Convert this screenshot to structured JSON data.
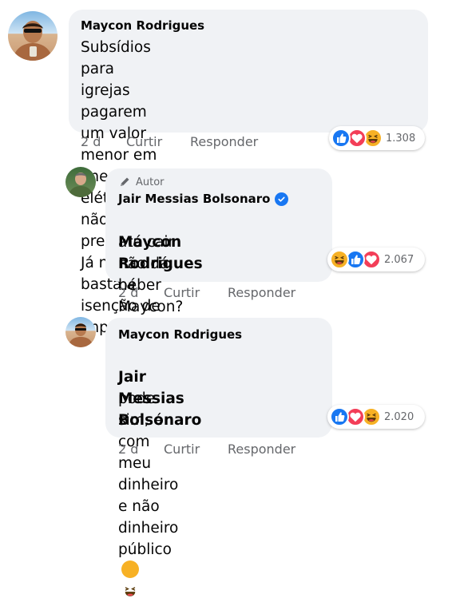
{
  "comments": [
    {
      "author": "Maycon Rodrigues",
      "text": "Subsídios para igrejas pagarem um valor\nmenor em energia elétrica, aí não né\npresidente. Já não basta a isenção de\nimpostos",
      "time": "2 d",
      "like_label": "Curtir",
      "reply_label": "Responder",
      "reaction_count": "1.308"
    },
    {
      "badge": "Autor",
      "author": "Jair Messias Bolsonaro",
      "tag": "Maycon Rodrigues",
      "text_first": " beber",
      "text_rest": "até cair não dá, né\nMaycon?",
      "time": "2 d",
      "like_label": "Curtir",
      "reply_label": "Responder",
      "reaction_count": "2.067"
    },
    {
      "author": "Maycon Rodrigues",
      "tag": "Jair Messias Bolsonaro",
      "text_rest": "pode sim, é com meu\ndinheiro e não dinheiro\npúblico",
      "time": "2 d",
      "like_label": "Curtir",
      "reply_label": "Responder",
      "reaction_count": "2.020"
    }
  ],
  "colors": {
    "bubble": "#f0f2f5",
    "meta": "#65676b",
    "like": "#1877f2",
    "love": "#f33e58",
    "haha": "#f7b125"
  },
  "icons": [
    "like-reaction-icon",
    "love-reaction-icon",
    "haha-reaction-icon",
    "verified-icon",
    "pencil-icon",
    "grinning-emoji-icon"
  ]
}
